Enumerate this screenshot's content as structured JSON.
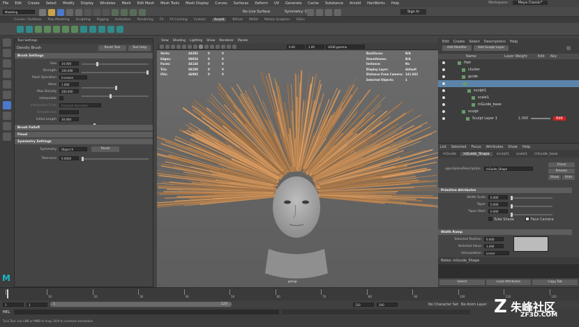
{
  "menu": [
    "File",
    "Edit",
    "Create",
    "Select",
    "Modify",
    "Display",
    "Windows",
    "Mesh",
    "Edit Mesh",
    "Mesh Tools",
    "Mesh Display",
    "Curves",
    "Surfaces",
    "Deform",
    "UV",
    "Generate",
    "Cache",
    "Substance",
    "Arnold",
    "HairWorks",
    "Help"
  ],
  "workspace_label": "Workspace :",
  "workspace_value": "Maya Classic*",
  "mode": "Modeling",
  "live_surface": "No Live Surface",
  "symmetry_status": "Symmetry: Off",
  "sign_in": "Sign In",
  "shelf_tabs": [
    "Curves / Surfaces",
    "Poly Modeling",
    "Sculpting",
    "Rigging",
    "Animation",
    "Rendering",
    "FX",
    "FX Caching",
    "Custom",
    "Arnold",
    "Bifrost",
    "MASH",
    "Motion Graphics",
    "XGen"
  ],
  "shelf_active": "Arnold",
  "tool_settings": {
    "title": "Tool Settings",
    "brush": "Density Brush",
    "reset": "Reset Tool",
    "help": "Tool Help",
    "brush_settings": "Brush Settings",
    "size_label": "Size",
    "size_value": "34.000",
    "strength_label": "Strength",
    "strength_value": "100.000",
    "paint_op_label": "Paint Operation",
    "paint_op_value": "Increase",
    "value_label": "Value",
    "value_value": "1.000",
    "maxd_label": "Max Density",
    "maxd_value": "200.000",
    "interp_label": "Interpolate",
    "interp_from_label": "Interpolate From",
    "interp_from_value": "Example descriptor",
    "smoothness_label": "Smoothness",
    "init_len_label": "Initial Length",
    "init_len_value": "30.000",
    "falloff": "Brush Falloff",
    "flood": "Flood",
    "symmetry_settings": "Symmetry Settings",
    "symmetry_label": "Symmetry",
    "symmetry_value": "Object X",
    "sym_reset": "Reset",
    "tolerance_label": "Tolerance",
    "tolerance_value": "0.0000"
  },
  "viewport": {
    "menu": [
      "View",
      "Shading",
      "Lighting",
      "Show",
      "Renderer",
      "Panels"
    ],
    "num1": "0.00",
    "num2": "1.00",
    "gamma": "sRGB gamma",
    "stats_labels": [
      "Verts:",
      "Edges:",
      "Faces:",
      "Tris:",
      "UVs:"
    ],
    "stats_a": [
      "44392",
      "88654",
      "44144",
      "88100",
      "46092"
    ],
    "stats_b": [
      "0",
      "0",
      "0",
      "0",
      "0"
    ],
    "stats_c": [
      "0",
      "0",
      "0",
      "0",
      "0"
    ],
    "info_labels": [
      "Backfaces:",
      "Smoothness:",
      "Instance:",
      "Display Layer:",
      "Distance From Camera:",
      "Selected Objects:"
    ],
    "info_values": [
      "N/A",
      "N/A",
      "No",
      "default",
      "141.932",
      "1"
    ],
    "camera": "persp"
  },
  "outliner": {
    "menu": [
      "Edit",
      "Create",
      "Select",
      "Descriptions",
      "Help"
    ],
    "add_modifier": "Add Modifier",
    "add_sculpt": "Add Sculpt Layer",
    "col_name": "Name",
    "col_layer": "Layer Weight",
    "col_edit": "Edit",
    "col_key": "Key",
    "items": [
      "Hair",
      "cluster",
      "guide",
      "",
      "sculpt1",
      "scale1",
      "inGuide_base",
      "sculpt",
      "Sculpt Layer 1"
    ],
    "layer_value": "1.000",
    "edit_btn": "Edit"
  },
  "attr": {
    "menu": [
      "List",
      "Selected",
      "Focus",
      "Attributes",
      "Show",
      "Help"
    ],
    "tabs": [
      "inGuide",
      "inGuide_Shape",
      "sculpt1",
      "scale1",
      "inGuide_base"
    ],
    "desc_label": "xgenSplineDescription:",
    "desc_value": "inGuide_Shape",
    "focus": "Focus",
    "presets": "Presets",
    "show": "Show",
    "hide": "Hide",
    "prim_title": "Primitive Attributes",
    "width_scale": "Width Scale",
    "width_scale_v": "0.000",
    "taper": "Taper",
    "taper_v": "0.000",
    "taper_start": "Taper Start",
    "taper_start_v": "0.000",
    "tube_shade": "Tube Shade",
    "face_camera": "Face Camera",
    "ramp_title": "Width Ramp",
    "sel_pos": "Selected Position",
    "sel_pos_v": "0.000",
    "sel_val": "Selected Value",
    "sel_val_v": "1.000",
    "interp": "Interpolation",
    "interp_v": "Linear",
    "notes": "Notes: inGuide_Shape",
    "btn_select": "Select",
    "btn_load": "Load Attributes",
    "btn_copy": "Copy Tab"
  },
  "timeline_ticks": [
    "1",
    "10",
    "20",
    "30",
    "40",
    "50",
    "60",
    "70",
    "80",
    "90",
    "100",
    "110",
    "120"
  ],
  "range": {
    "start": "1",
    "cur": "1",
    "range_start": "1",
    "range_end": "120",
    "end1": "120",
    "end2": "200",
    "no_char": "No Character Set",
    "no_anim": "No Anim Layer"
  },
  "cmd": {
    "label": "MEL",
    "help": "Tuck Tool: Use LMB or MMB to drag. Shift to constrain translation."
  },
  "watermark": "朱峰社区",
  "watermark_sub": "ZF3D.COM"
}
